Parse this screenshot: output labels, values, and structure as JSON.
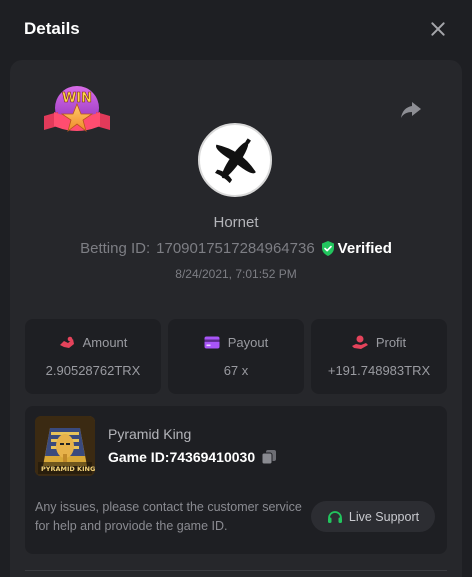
{
  "header": {
    "title": "Details"
  },
  "player": {
    "username": "Hornet",
    "betting_id_label": "Betting ID:",
    "betting_id": "1709017517284964736",
    "verified_label": "Verified",
    "timestamp": "8/24/2021, 7:01:52 PM"
  },
  "badge": {
    "text": "WIN"
  },
  "stats": [
    {
      "label": "Amount",
      "value": "2.90528762TRX",
      "icon": "amount-icon",
      "color": "#e5435b"
    },
    {
      "label": "Payout",
      "value": "67 x",
      "icon": "payout-icon",
      "color": "#a855f7"
    },
    {
      "label": "Profit",
      "value": "+191.748983TRX",
      "icon": "profit-icon",
      "color": "#e5435b"
    }
  ],
  "game": {
    "name": "Pyramid King",
    "id_label": "Game ID:",
    "id": "74369410030",
    "thumb_text": "PYRAMID KING"
  },
  "support": {
    "message": "Any issues, please contact the customer service for help and proviode the game ID.",
    "button_label": "Live Support"
  },
  "colors": {
    "accent_green": "#22c55e",
    "panel": "#26272b",
    "card": "#1e1f23"
  }
}
